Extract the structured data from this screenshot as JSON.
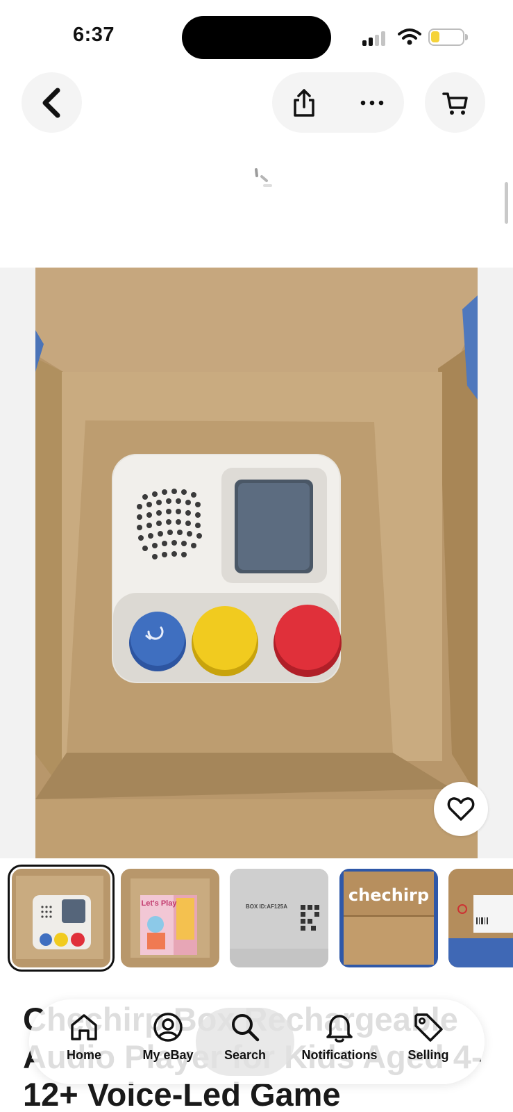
{
  "status_bar": {
    "time": "6:37"
  },
  "top_nav": {
    "back_icon": "chevron-left-icon",
    "share_icon": "share-icon",
    "more_icon": "more-horizontal-icon",
    "cart_icon": "shopping-cart-icon"
  },
  "hero": {
    "favorite_icon": "heart-outline-icon"
  },
  "thumbnails": [
    {
      "alt": "device in box",
      "selected": true
    },
    {
      "alt": "story book in box",
      "selected": false,
      "label": "Let's Play"
    },
    {
      "alt": "device back label",
      "selected": false,
      "label": "BOX ID:AF125A"
    },
    {
      "alt": "brand box",
      "selected": false,
      "label": "chechirp"
    },
    {
      "alt": "shipping label",
      "selected": false
    }
  ],
  "listing": {
    "title": "Chechirp Box Rechargeable Audio Player for Kids Aged 4-12+ Voice-Led Game"
  },
  "bottom_nav": {
    "items": [
      {
        "label": "Home",
        "icon": "home-icon"
      },
      {
        "label": "My eBay",
        "icon": "account-icon"
      },
      {
        "label": "Search",
        "icon": "search-icon",
        "active": true
      },
      {
        "label": "Notifications",
        "icon": "bell-icon"
      },
      {
        "label": "Selling",
        "icon": "tag-icon"
      }
    ]
  },
  "colors": {
    "battery": "#f5d33a",
    "cardboard": "#bf9f76",
    "button_blue": "#3f6fc0",
    "button_yellow": "#f1cb1f",
    "button_red": "#e0303a"
  }
}
